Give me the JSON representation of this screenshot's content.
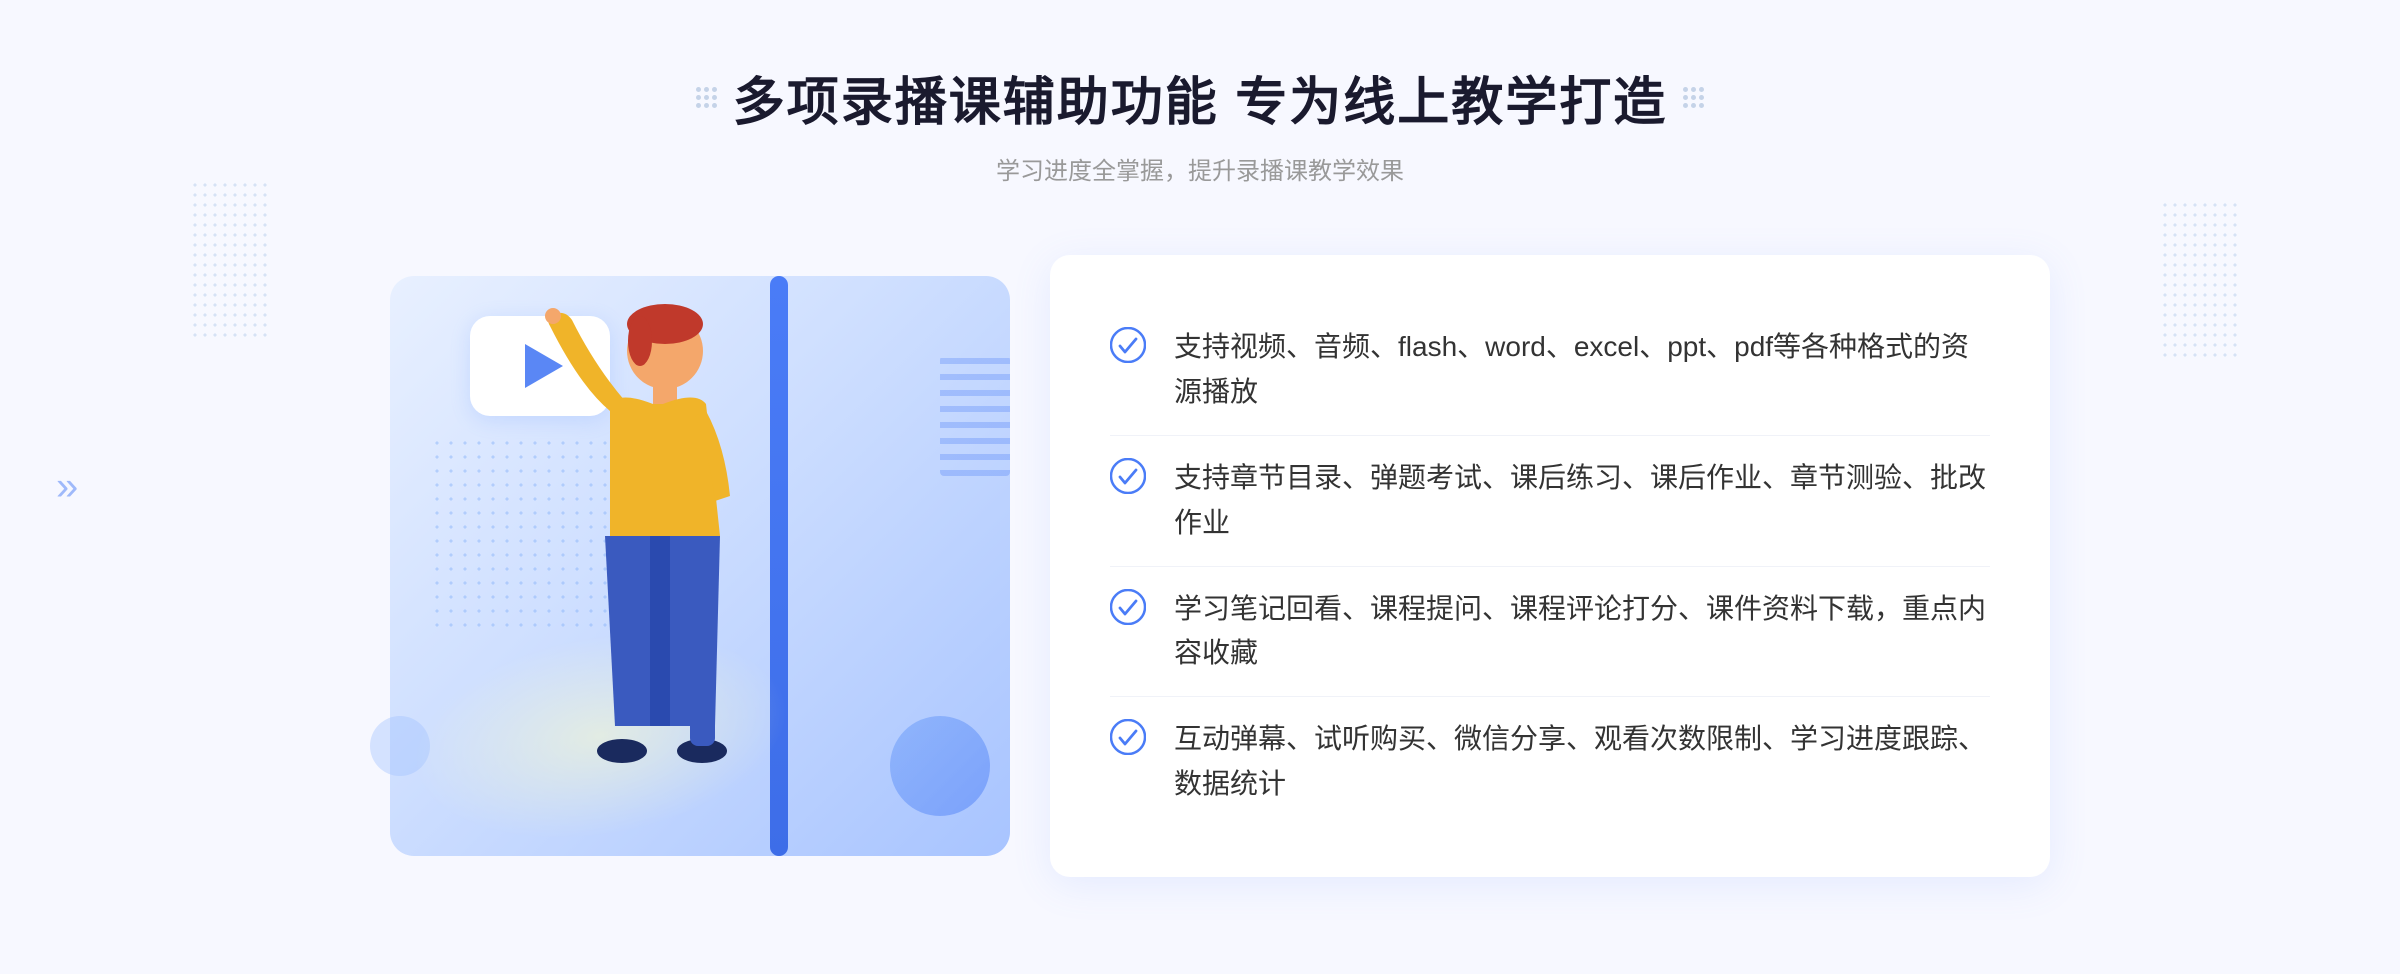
{
  "header": {
    "title": "多项录播课辅助功能 专为线上教学打造",
    "subtitle": "学习进度全掌握，提升录播课教学效果"
  },
  "features": [
    {
      "id": 1,
      "text": "支持视频、音频、flash、word、excel、ppt、pdf等各种格式的资源播放"
    },
    {
      "id": 2,
      "text": "支持章节目录、弹题考试、课后练习、课后作业、章节测验、批改作业"
    },
    {
      "id": 3,
      "text": "学习笔记回看、课程提问、课程评论打分、课件资料下载，重点内容收藏"
    },
    {
      "id": 4,
      "text": "互动弹幕、试听购买、微信分享、观看次数限制、学习进度跟踪、数据统计"
    }
  ],
  "decorations": {
    "chevron": "»",
    "checkColor": "#4a7cf7"
  }
}
